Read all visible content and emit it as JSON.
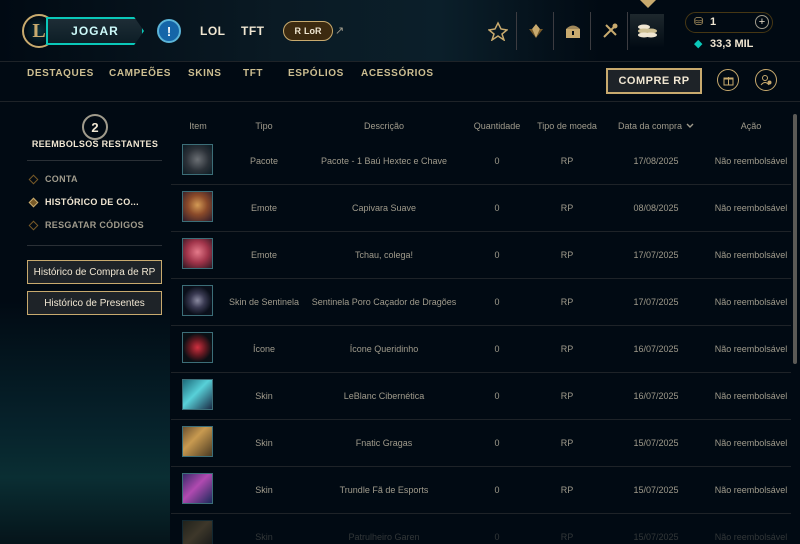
{
  "topbar": {
    "logo_letter": "L",
    "play_label": "JOGAR",
    "alert_symbol": "!",
    "lol_label": "LOL",
    "tft_label": "TFT",
    "lor_label": "LoR",
    "lor_icon": "R",
    "lor_arrow": "↗",
    "icons": [
      "ranked-icon",
      "collection-icon",
      "loot-icon",
      "champion-icon",
      "store-icon"
    ],
    "rp_icon": "⛁",
    "rp_amount": "1",
    "plus": "+",
    "be_icon": "◆",
    "be_amount": "33,3 MIL"
  },
  "subnav": {
    "items": [
      "DESTAQUES",
      "CAMPEÕES",
      "SKINS",
      "TFT",
      "ESPÓLIOS",
      "ACESSÓRIOS"
    ],
    "buy_rp_label": "COMPRE RP"
  },
  "sidebar": {
    "refunds_count": "2",
    "refunds_label": "REEMBOLSOS RESTANTES",
    "menu": [
      {
        "label": "CONTA",
        "active": false
      },
      {
        "label": "HISTÓRICO DE CO...",
        "active": true
      },
      {
        "label": "RESGATAR CÓDIGOS",
        "active": false
      }
    ],
    "rp_history_button": "Histórico de Compra de RP",
    "gift_history_button": "Histórico de Presentes"
  },
  "table": {
    "headers": {
      "item": "Item",
      "type": "Tipo",
      "description": "Descrição",
      "quantity": "Quantidade",
      "currency": "Tipo de moeda",
      "date": "Data da compra",
      "action": "Ação"
    },
    "rows": [
      {
        "type": "Pacote",
        "description": "Pacote - 1 Baú Hextec e Chave",
        "quantity": "0",
        "currency": "RP",
        "date": "17/08/2025",
        "action": "Não reembolsável"
      },
      {
        "type": "Emote",
        "description": "Capivara Suave",
        "quantity": "0",
        "currency": "RP",
        "date": "08/08/2025",
        "action": "Não reembolsável"
      },
      {
        "type": "Emote",
        "description": "Tchau, colega!",
        "quantity": "0",
        "currency": "RP",
        "date": "17/07/2025",
        "action": "Não reembolsável"
      },
      {
        "type": "Skin de Sentinela",
        "description": "Sentinela Poro Caçador de Dragões",
        "quantity": "0",
        "currency": "RP",
        "date": "17/07/2025",
        "action": "Não reembolsável"
      },
      {
        "type": "Ícone",
        "description": "Ícone Queridinho",
        "quantity": "0",
        "currency": "RP",
        "date": "16/07/2025",
        "action": "Não reembolsável"
      },
      {
        "type": "Skin",
        "description": "LeBlanc Cibernética",
        "quantity": "0",
        "currency": "RP",
        "date": "16/07/2025",
        "action": "Não reembolsável"
      },
      {
        "type": "Skin",
        "description": "Fnatic Gragas",
        "quantity": "0",
        "currency": "RP",
        "date": "15/07/2025",
        "action": "Não reembolsável"
      },
      {
        "type": "Skin",
        "description": "Trundle Fã de Esports",
        "quantity": "0",
        "currency": "RP",
        "date": "15/07/2025",
        "action": "Não reembolsável"
      },
      {
        "type": "Skin",
        "description": "Patrulheiro Garen",
        "quantity": "0",
        "currency": "RP",
        "date": "15/07/2025",
        "action": "Não reembolsável"
      }
    ]
  },
  "colors": {
    "gold": "#c8aa6e",
    "teal": "#0ac8b9",
    "text": "#a09b8c",
    "background": "#010a13"
  }
}
